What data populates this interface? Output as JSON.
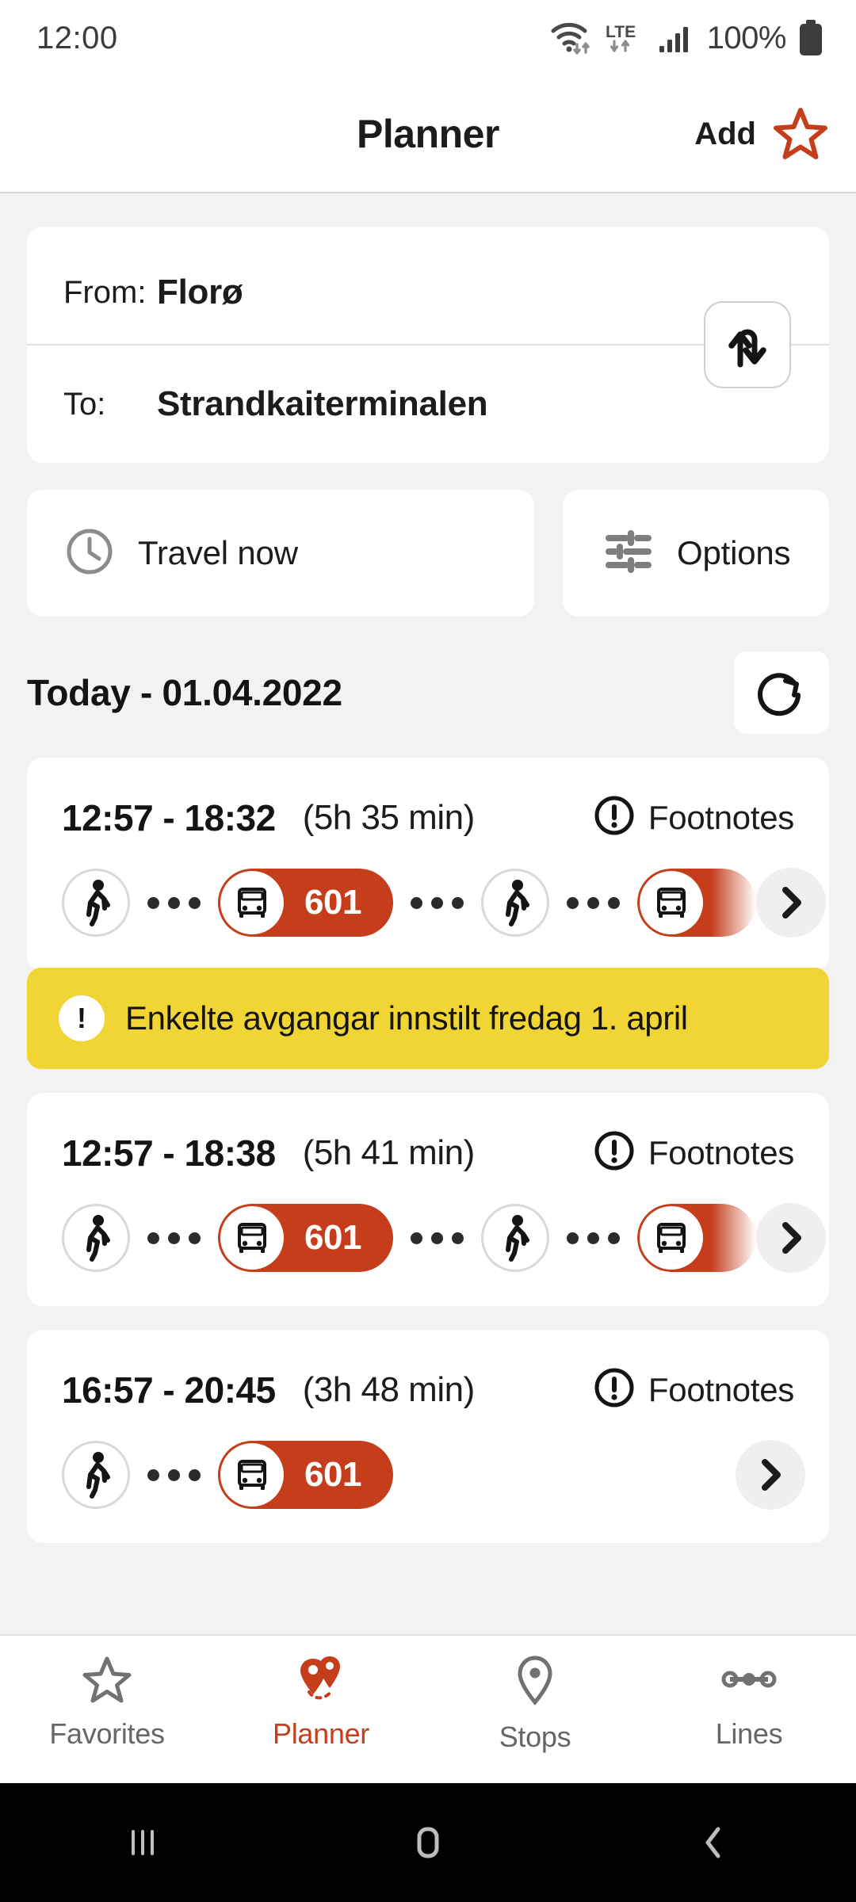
{
  "statusbar": {
    "time": "12:00",
    "battery_percent": "100%",
    "icons": [
      "wifi-icon",
      "lte-icon",
      "signal-icon",
      "battery-icon"
    ]
  },
  "header": {
    "title": "Planner",
    "add_label": "Add",
    "star_icon": "star-outline-icon"
  },
  "search": {
    "from_label": "From:",
    "from_value": "Florø",
    "to_label": "To:",
    "to_value": "Strandkaiterminalen",
    "swap_icon": "swap-vertical-icon"
  },
  "controls": {
    "travel_now_label": "Travel now",
    "travel_now_icon": "clock-icon",
    "options_label": "Options",
    "options_icon": "tune-icon"
  },
  "results_header": {
    "date_label": "Today - 01.04.2022",
    "refresh_icon": "refresh-icon"
  },
  "trips": [
    {
      "times": "12:57 - 18:32",
      "duration": "(5h 35 min)",
      "footnotes_label": "Footnotes",
      "footnotes_icon": "exclamation-circle-icon",
      "legs": [
        {
          "type": "walk",
          "icon": "walk-icon"
        },
        {
          "type": "bus",
          "icon": "bus-icon",
          "line": "601"
        },
        {
          "type": "walk",
          "icon": "walk-icon"
        },
        {
          "type": "bus",
          "icon": "bus-icon",
          "line": "",
          "truncated": true
        }
      ],
      "chevron_icon": "chevron-right-icon",
      "warning": {
        "text": "Enkelte avgangar innstilt fredag 1. april",
        "icon": "exclamation-icon",
        "color": "#f0d535"
      }
    },
    {
      "times": "12:57 - 18:38",
      "duration": "(5h 41 min)",
      "footnotes_label": "Footnotes",
      "footnotes_icon": "exclamation-circle-icon",
      "legs": [
        {
          "type": "walk",
          "icon": "walk-icon"
        },
        {
          "type": "bus",
          "icon": "bus-icon",
          "line": "601"
        },
        {
          "type": "walk",
          "icon": "walk-icon"
        },
        {
          "type": "bus",
          "icon": "bus-icon",
          "line": "",
          "truncated": true
        }
      ],
      "chevron_icon": "chevron-right-icon"
    },
    {
      "times": "16:57 - 20:45",
      "duration": "(3h 48 min)",
      "footnotes_label": "Footnotes",
      "footnotes_icon": "exclamation-circle-icon",
      "legs": [
        {
          "type": "walk",
          "icon": "walk-icon"
        },
        {
          "type": "bus",
          "icon": "bus-icon",
          "line": "601"
        }
      ],
      "chevron_icon": "chevron-right-icon"
    }
  ],
  "tabbar": {
    "items": [
      {
        "label": "Favorites",
        "icon": "star-outline-icon",
        "active": false
      },
      {
        "label": "Planner",
        "icon": "двух-pins-icon",
        "active": true
      },
      {
        "label": "Stops",
        "icon": "map-pin-icon",
        "active": false
      },
      {
        "label": "Lines",
        "icon": "line-dots-icon",
        "active": false
      }
    ]
  },
  "navbar": {
    "recents_icon": "recents-icon",
    "home_icon": "home-icon",
    "back_icon": "back-icon"
  },
  "colors": {
    "brand_red": "#c53d1b",
    "warning_yellow": "#f0d535",
    "page_bg": "#f2f2f2"
  }
}
